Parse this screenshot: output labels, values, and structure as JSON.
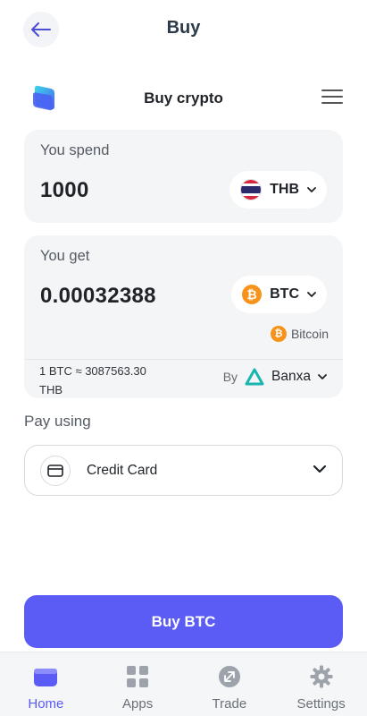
{
  "header": {
    "title": "Buy",
    "back_icon": "arrow-left-icon"
  },
  "widget": {
    "title": "Buy crypto",
    "logo_icon": "app-logo-icon",
    "menu_icon": "hamburger-menu-icon"
  },
  "spend": {
    "label": "You spend",
    "amount": "1000",
    "currency": "THB",
    "flag_icon": "thailand-flag-icon"
  },
  "receive": {
    "label": "You get",
    "amount": "0.00032388",
    "currency": "BTC",
    "coin_name": "Bitcoin",
    "coin_icon": "bitcoin-icon"
  },
  "rate": {
    "text_line1": "1 BTC ≈ 3087563.30",
    "text_line2": "THB"
  },
  "provider": {
    "by_label": "By",
    "name": "Banxa",
    "logo_icon": "banxa-logo-icon"
  },
  "payment": {
    "label": "Pay using",
    "method": "Credit Card",
    "method_icon": "credit-card-icon"
  },
  "cta": {
    "label": "Buy BTC"
  },
  "nav": {
    "items": [
      {
        "label": "Home",
        "icon": "wallet-icon",
        "active": true
      },
      {
        "label": "Apps",
        "icon": "apps-grid-icon",
        "active": false
      },
      {
        "label": "Trade",
        "icon": "trade-icon",
        "active": false
      },
      {
        "label": "Settings",
        "icon": "gear-icon",
        "active": false
      }
    ]
  },
  "colors": {
    "accent": "#5b5bf6",
    "bitcoin": "#f7931a",
    "banxa": "#19b5b0",
    "card_bg": "#f4f5f7"
  }
}
